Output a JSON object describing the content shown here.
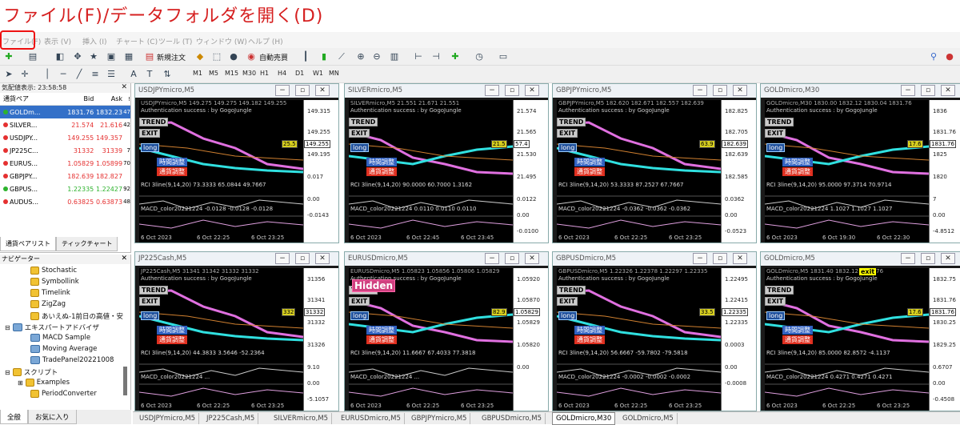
{
  "caption": "ファイル(F)/データフォルダを開く(D)",
  "menu": [
    "ファイル(F)",
    "表示 (V)",
    "挿入 (I)",
    "チャート (C)",
    "ツール (T)",
    "ウィンドウ (W)",
    "ヘルプ (H)"
  ],
  "toolbar": {
    "new_order": "新規注文",
    "auto_trade": "自動売買"
  },
  "timeframes": [
    "M1",
    "M5",
    "M15",
    "M30",
    "H1",
    "H4",
    "D1",
    "W1",
    "MN"
  ],
  "market_watch": {
    "title": "気配値表示: 23:58:58",
    "headers": {
      "pair": "通貨ペア",
      "bid": "Bid",
      "ask": "Ask",
      "spread": "!"
    },
    "rows": [
      {
        "pair": "GOLDm...",
        "bid": "1831.76",
        "ask": "1832.23",
        "spread": "47",
        "color": "#2db32d"
      },
      {
        "pair": "SILVER...",
        "bid": "21.574",
        "ask": "21.616",
        "spread": "42",
        "color": "#e53030"
      },
      {
        "pair": "USDJPY...",
        "bid": "149.255",
        "ask": "149.357",
        "spread": "",
        "color": "#e53030"
      },
      {
        "pair": "JP225C...",
        "bid": "31332",
        "ask": "31339",
        "spread": "7",
        "color": "#e53030"
      },
      {
        "pair": "EURUS...",
        "bid": "1.05829",
        "ask": "1.05899",
        "spread": "70",
        "color": "#e53030"
      },
      {
        "pair": "GBPJPY...",
        "bid": "182.639",
        "ask": "182.827",
        "spread": "",
        "color": "#e53030"
      },
      {
        "pair": "GBPUS...",
        "bid": "1.22335",
        "ask": "1.22427",
        "spread": "92",
        "color": "#2db32d"
      },
      {
        "pair": "AUDUS...",
        "bid": "0.63825",
        "ask": "0.63873",
        "spread": "48",
        "color": "#e53030"
      }
    ],
    "tabs": [
      "通貨ペアリスト",
      "ティックチャート"
    ]
  },
  "navigator": {
    "title": "ナビゲーター",
    "items": [
      "Stochastic",
      "Symbollink",
      "Timelink",
      "ZigZag",
      "あいえぬ-1前日の高値・安",
      "エキスパートアドバイザ",
      "MACD Sample",
      "Moving Average",
      "TradePanel20221008",
      "スクリプト",
      "Examples",
      "PeriodConverter"
    ],
    "tabs": [
      "全般",
      "お気に入り"
    ]
  },
  "charts": [
    {
      "title": "USDJPYmicro,M5",
      "header": "USDJPYmicro,M5 149.275 149.275 149.182 149.255",
      "axis": [
        "149.315",
        "149.255",
        "149.195",
        "0.017",
        "0.00",
        "-0.0143"
      ],
      "dates": [
        "6 Oct 2023",
        "6 Oct 22:25",
        "6 Oct 23:25"
      ],
      "rci": "RCI 3line(9,14,20) 73.3333 65.0844 49.7667",
      "macd": "MACD_color20221224 -0.0128 -0.0128 -0.0128",
      "price_tag": "25.5",
      "bid_tag": "149.255"
    },
    {
      "title": "SILVERmicro,M5",
      "header": "SILVERmicro,M5 21.551 21.671 21.551",
      "axis": [
        "21.574",
        "21.565",
        "21.530",
        "21.495",
        "0.0122",
        "0.00",
        "-0.0100"
      ],
      "dates": [
        "6 Oct 2023",
        "6 Oct 22:45",
        "6 Oct 23:45"
      ],
      "rci": "RCI 3line(9,14,20) 90.0000 60.7000 1.3162",
      "macd": "MACD_color20221224 0.0110 0.0110 0.0110",
      "price_tag": "21.5",
      "bid_tag": "57.4"
    },
    {
      "title": "GBPJPYmicro,M5",
      "header": "GBPJPYmicro,M5 182.620 182.671 182.557 182.639",
      "axis": [
        "182.825",
        "182.705",
        "182.639",
        "182.585",
        "0.0362",
        "0.00",
        "-0.0523"
      ],
      "dates": [
        "6 Oct 2023",
        "6 Oct 22:25",
        "6 Oct 23:25"
      ],
      "rci": "RCI 3line(9,14,20) 53.3333 87.2527 67.7667",
      "macd": "MACD_color20221224 -0.0362 -0.0362 -0.0362",
      "price_tag": "63.9",
      "bid_tag": "182.639"
    },
    {
      "title": "GOLDmicro,M30",
      "header": "GOLDmicro,M30 1830.00 1832.12 1830.04 1831.76",
      "axis": [
        "1836",
        "1831.76",
        "1825",
        "1820",
        "7",
        "0.00",
        "-4.8512"
      ],
      "dates": [
        "6 Oct 2023",
        "6 Oct 19:30",
        "6 Oct 22:30"
      ],
      "rci": "RCI 3line(9,14,20) 95.0000 97.3714 70.9714",
      "macd": "MACD_color20221224 1.1027 1.1027 1.1027",
      "price_tag": "17.6",
      "bid_tag": "1831.76"
    },
    {
      "title": "JP225Cash,M5",
      "header": "JP225Cash,M5 31341 31342 31332 31332",
      "axis": [
        "31356",
        "31341",
        "31332",
        "31326",
        "9.10",
        "0.00",
        "-5.1057"
      ],
      "dates": [
        "6 Oct 2023",
        "6 Oct 22:25",
        "6 Oct 23:25"
      ],
      "rci": "RCI 3line(9,14,20) 44.3833 3.5646 -52.2364",
      "macd": "MACD_color20221224 ...",
      "price_tag": "332",
      "bid_tag": "31332"
    },
    {
      "title": "EURUSDmicro,M5",
      "header": "EURUSDmicro,M5 1.05823 1.05856 1.05806 1.05829",
      "axis": [
        "1.05920",
        "1.05870",
        "1.05829",
        "1.05820",
        "0.00"
      ],
      "dates": [
        "6 Oct 2023",
        "6 Oct 22:25",
        "6 Oct 23:25"
      ],
      "rci": "RCI 3line(9,14,20) 11.6667 67.4033 77.3818",
      "macd": "MACD_color20221224 ...",
      "price_tag": "82.9",
      "bid_tag": "1.05829"
    },
    {
      "title": "GBPUSDmicro,M5",
      "header": "GBPUSDmicro,M5 1.22326 1.22378 1.22297 1.22335",
      "axis": [
        "1.22495",
        "1.22415",
        "1.22335",
        "0.0003",
        "0.00",
        "-0.0008"
      ],
      "dates": [
        "6 Oct 2023",
        "6 Oct 22:25",
        "6 Oct 23:25"
      ],
      "rci": "RCI 3line(9,14,20) 56.6667 -59.7802 -79.5818",
      "macd": "MACD_color20221224 -0.0002 -0.0002 -0.0002",
      "price_tag": "33.5",
      "bid_tag": "1.22335"
    },
    {
      "title": "GOLDmicro,M5",
      "header": "GOLDmicro,M5 1831.40 1832.12 1831.76",
      "axis": [
        "1832.75",
        "1831.76",
        "1830.25",
        "1829.25",
        "0.6707",
        "0.00",
        "-0.4508"
      ],
      "dates": [
        "6 Oct 2023",
        "6 Oct 22:25",
        "6 Oct 23:25"
      ],
      "rci": "RCI 3line(9,14,20) 85.0000 82.8572 -4.1137",
      "macd": "MACD_color20221224 0.4271 0.4271 0.4271",
      "price_tag": "17.6",
      "bid_tag": "1831.76"
    }
  ],
  "chart_labels": {
    "auth": "Authentication success : by GogoJungle",
    "trend": "TREND",
    "exit": "EXIT",
    "long": "long",
    "time_adj": "時間調整",
    "currency_adj": "通貨調整",
    "hidden": "Hidden",
    "exit_small": "exit"
  },
  "bottom_tabs": [
    "USDJPYmicro,M5",
    "JP225Cash,M5",
    "SILVERmicro,M5",
    "EURUSDmicro,M5",
    "GBPJPYmicro,M5",
    "GBPUSDmicro,M5",
    "GOLDmicro,M30",
    "GOLDmicro,M5"
  ],
  "active_tab": "GOLDmicro,M30"
}
